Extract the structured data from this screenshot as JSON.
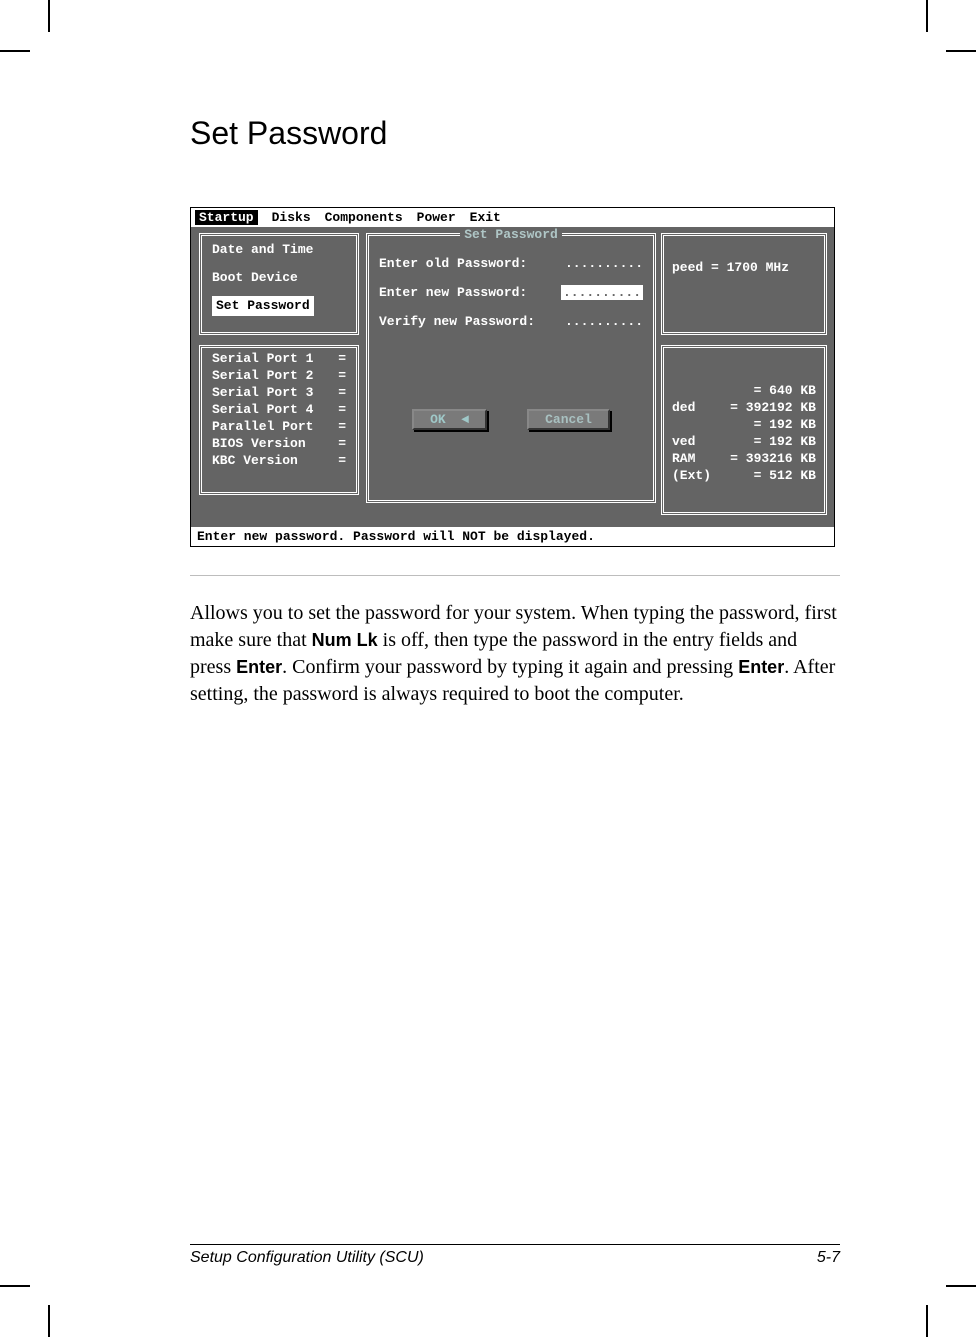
{
  "heading": "Set Password",
  "menubar": {
    "items": [
      "Startup",
      "Disks",
      "Components",
      "Power",
      "Exit"
    ],
    "active_index": 0
  },
  "left_panel_1": {
    "items": [
      "Date and Time",
      "Boot Device",
      "Set Password"
    ],
    "selected_index": 2
  },
  "left_panel_2": {
    "rows": [
      {
        "label": "Serial Port 1",
        "val": "="
      },
      {
        "label": "Serial Port 2",
        "val": "="
      },
      {
        "label": "Serial Port 3",
        "val": "="
      },
      {
        "label": "Serial Port 4",
        "val": "="
      },
      {
        "label": "Parallel Port",
        "val": "="
      },
      {
        "label": "BIOS Version",
        "val": "="
      },
      {
        "label": "KBC  Version",
        "val": "="
      }
    ]
  },
  "dialog": {
    "title": "Set Password",
    "fields": [
      {
        "label": "Enter old Password:",
        "value": ".........."
      },
      {
        "label": "Enter new Password:",
        "value": ".........."
      },
      {
        "label": "Verify new Password:",
        "value": ".........."
      }
    ],
    "focus_field_index": 1,
    "ok_label": "OK",
    "cancel_label": "Cancel"
  },
  "right_panel_1": {
    "text": "peed = 1700 MHz"
  },
  "right_panel_2": {
    "rows": [
      {
        "label": "",
        "val": "=    640 KB"
      },
      {
        "label": "ded",
        "val": "= 392192 KB"
      },
      {
        "label": "",
        "val": "=    192 KB"
      },
      {
        "label": "ved",
        "val": "=    192 KB"
      },
      {
        "label": "RAM",
        "val": "= 393216 KB"
      },
      {
        "label": "(Ext)",
        "val": "=    512 KB"
      }
    ]
  },
  "statusbar": "Enter new password. Password will NOT be displayed.",
  "body": {
    "p1a": "Allows you to set the password for your system. When typing the password, first make sure that ",
    "key1": "Num Lk",
    "p1b": " is off, then type the password in the entry fields and press ",
    "key2": "Enter",
    "p1c": ". Confirm your password by typing it again and pressing ",
    "key3": "Enter",
    "p1d": ". After setting, the password is always required to boot the computer."
  },
  "footer": {
    "left": "Setup Configuration Utility (SCU)",
    "right": "5-7"
  }
}
